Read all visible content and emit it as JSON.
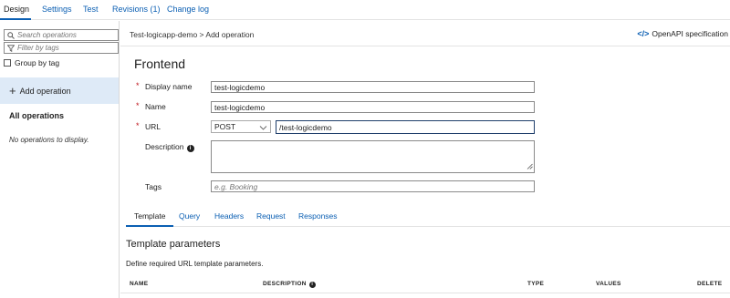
{
  "top_tabs": {
    "design": "Design",
    "settings": "Settings",
    "test": "Test",
    "revisions": "Revisions (1)",
    "changelog": "Change log"
  },
  "sidebar": {
    "search_placeholder": "Search operations",
    "filter_placeholder": "Filter by tags",
    "group_by_tag": "Group by tag",
    "add_operation": "Add operation",
    "all_operations": "All operations",
    "empty_text": "No operations to display."
  },
  "header": {
    "breadcrumb": "Test-logicapp-demo > Add operation",
    "openapi_label": "OpenAPI specification",
    "openapi_icon": "</>"
  },
  "frontend": {
    "title": "Frontend",
    "display_name_label": "Display name",
    "display_name_value": "test-logicdemo",
    "name_label": "Name",
    "name_value": "test-logicdemo",
    "url_label": "URL",
    "method_value": "POST",
    "url_value": "/test-logicdemo",
    "description_label": "Description",
    "tags_label": "Tags",
    "tags_placeholder": "e.g. Booking",
    "required_mark": "*"
  },
  "sub_tabs": {
    "template": "Template",
    "query": "Query",
    "headers": "Headers",
    "request": "Request",
    "responses": "Responses"
  },
  "template_params": {
    "title": "Template parameters",
    "description": "Define required URL template parameters.",
    "columns": {
      "name": "NAME",
      "description": "DESCRIPTION",
      "type": "TYPE",
      "values": "VALUES",
      "delete": "DELETE"
    }
  },
  "colors": {
    "accent": "#0b5fb3",
    "required": "#c0161e",
    "selected_bg": "#deeaf7"
  }
}
